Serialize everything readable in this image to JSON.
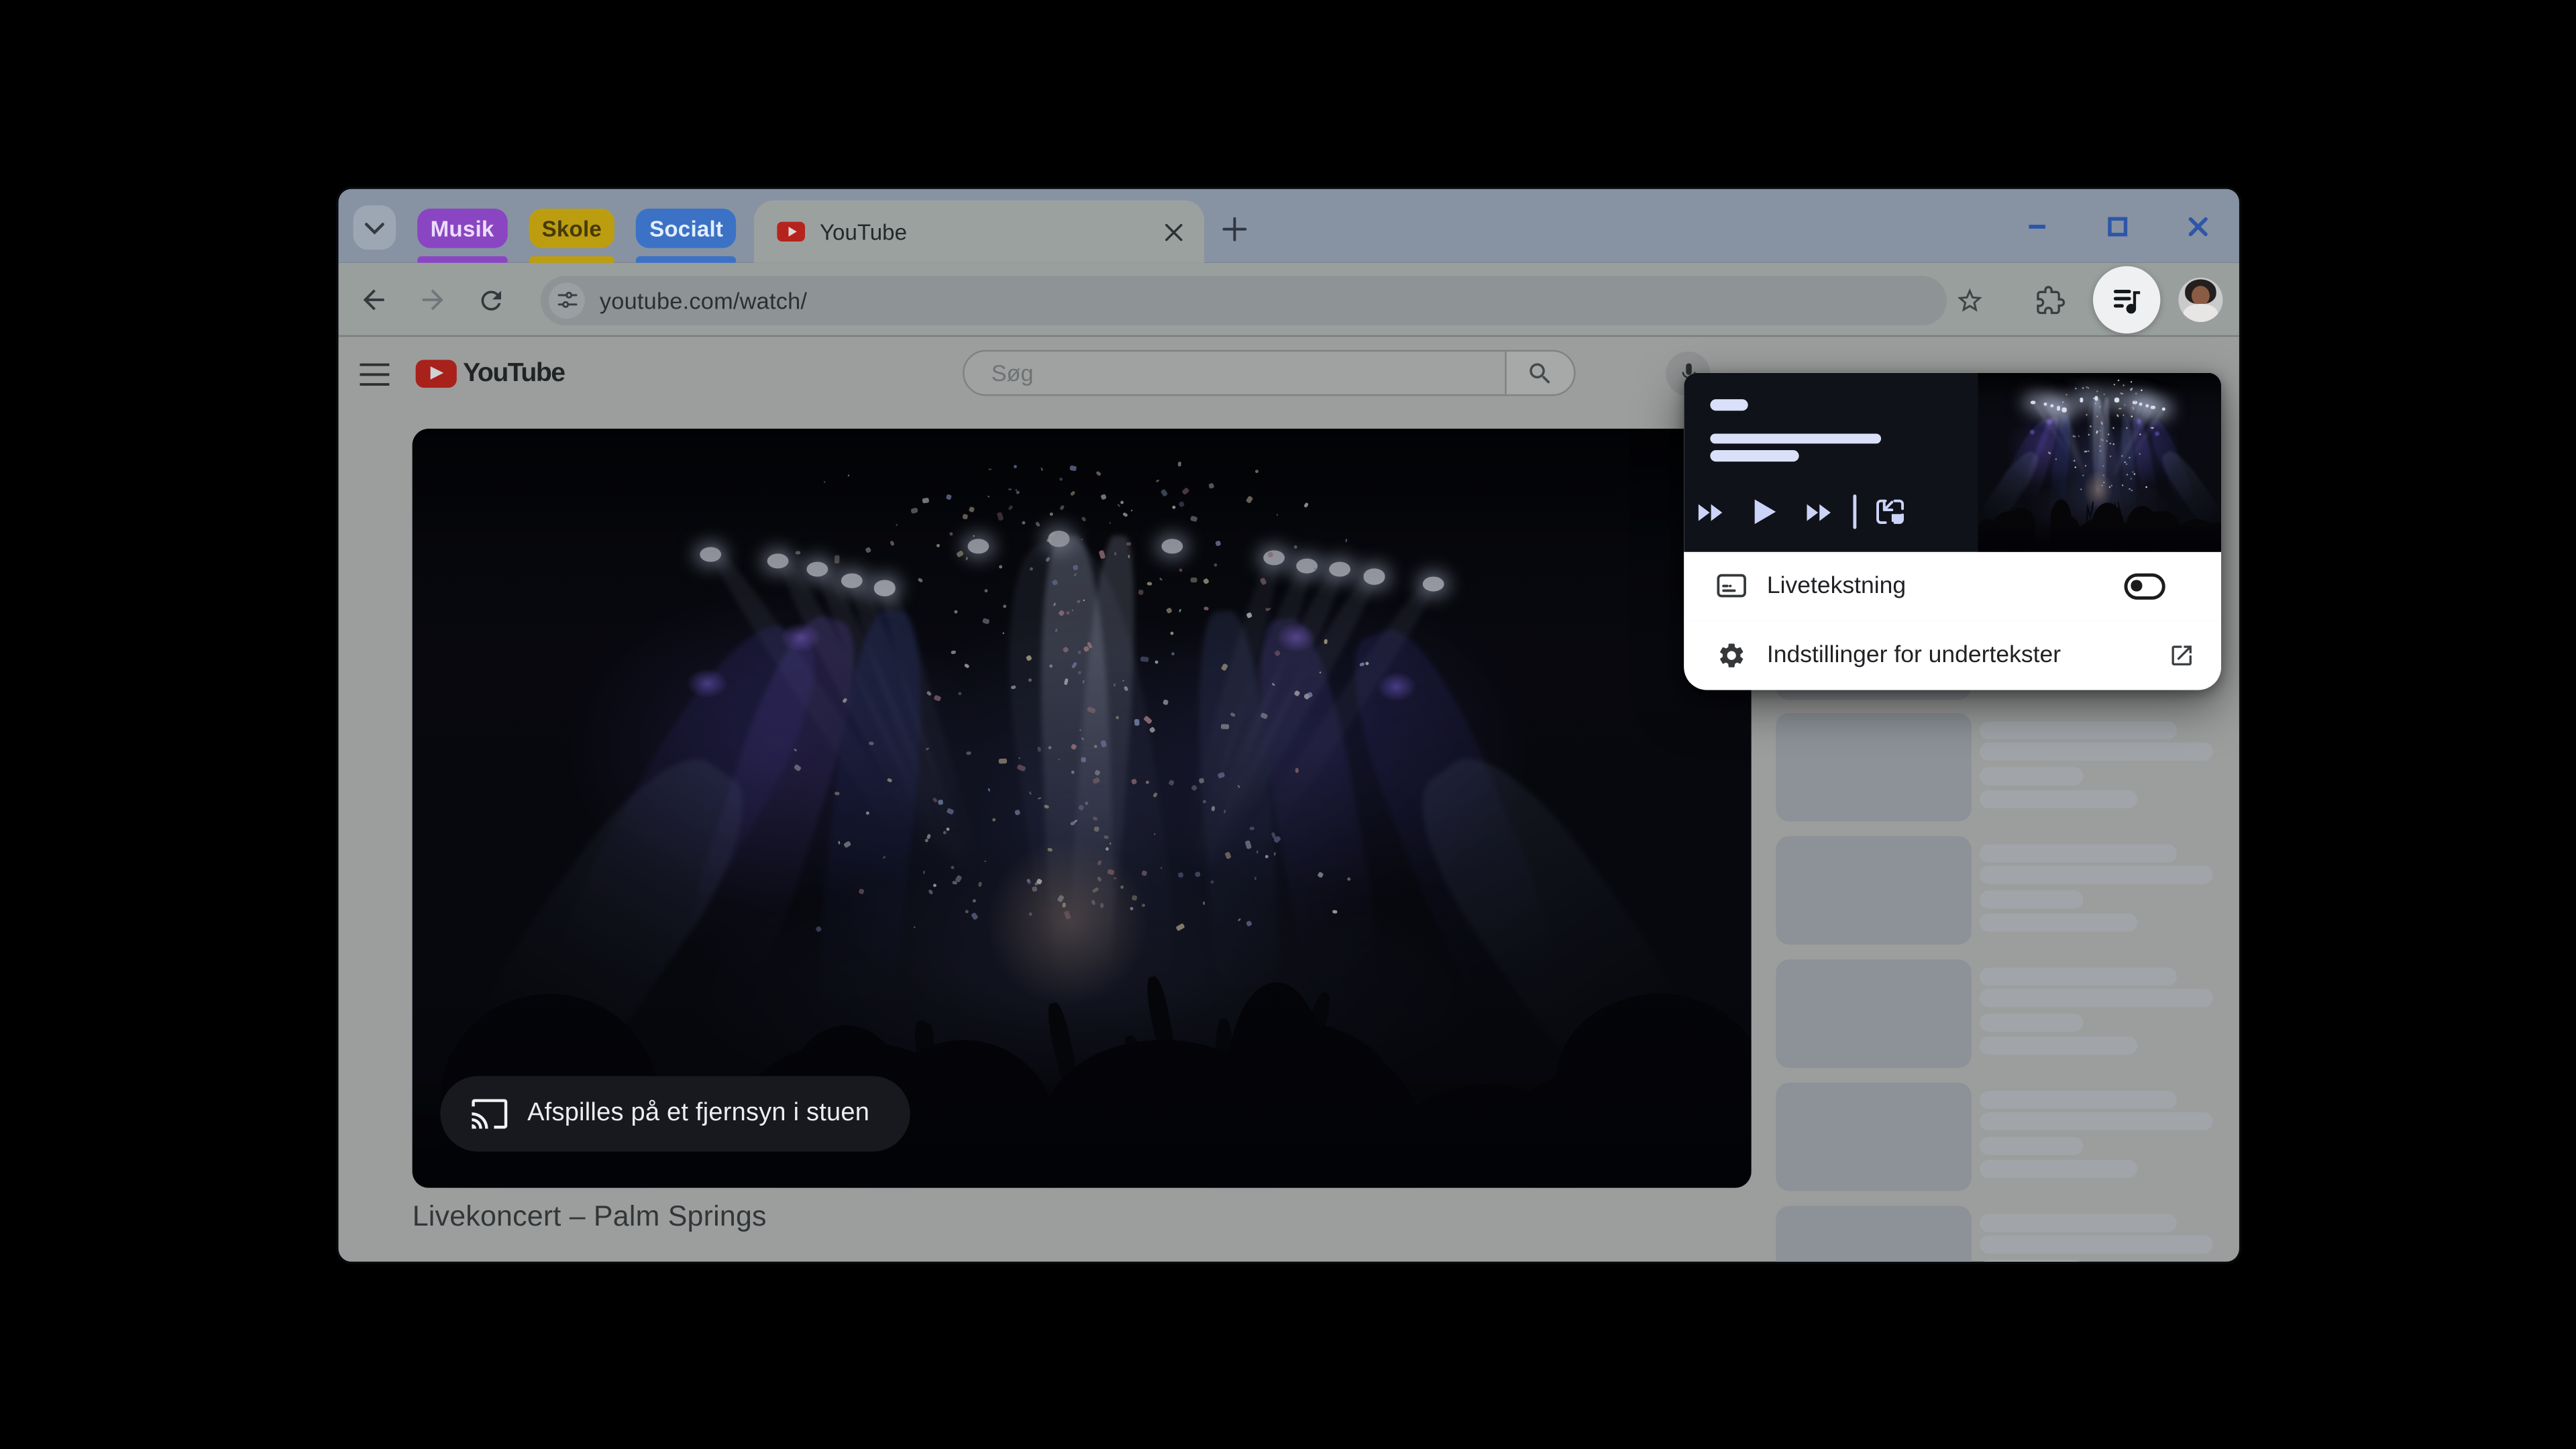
{
  "browser": {
    "tab_strip": {
      "groups": [
        {
          "label": "Musik",
          "color": "#8a46c2",
          "text_color": "#ecddfb"
        },
        {
          "label": "Skole",
          "color": "#bd9d10",
          "text_color": "#453a0b"
        },
        {
          "label": "Socialt",
          "color": "#3b72c6",
          "text_color": "#e3eefb"
        }
      ],
      "active_tab": {
        "title": "YouTube",
        "favicon": "youtube-icon"
      }
    },
    "toolbar": {
      "url": "youtube.com/watch/"
    },
    "colors": {
      "window_control_accent": "#2e56a8",
      "frame": "#8793a2"
    }
  },
  "youtube": {
    "header": {
      "search_placeholder": "Søg"
    },
    "player": {
      "cast_banner": "Afspilles på et fjernsyn i stuen"
    },
    "video_title": "Livekoncert – Palm Springs",
    "sidebar": {
      "skeleton_item_count": 6,
      "skeleton_line_widths": [
        120,
        142,
        63,
        96
      ]
    }
  },
  "media_popup": {
    "controls": [
      "previous-track",
      "play",
      "next-track",
      "picture-in-picture"
    ],
    "menu": [
      {
        "label": "Livetekstning",
        "control": "toggle",
        "enabled": false
      },
      {
        "label": "Indstillinger for undertekster",
        "control": "external-link"
      }
    ],
    "colors": {
      "card": "#0f1218",
      "skeleton": "#dbe0f9"
    }
  }
}
